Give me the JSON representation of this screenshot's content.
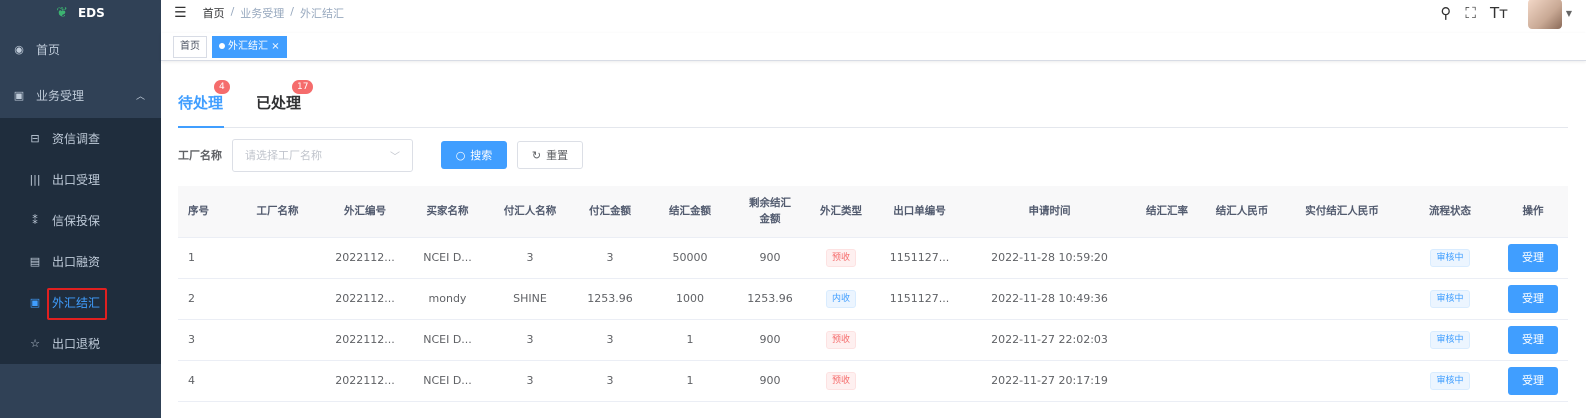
{
  "app": {
    "name": "EDS"
  },
  "sidebar": {
    "items": [
      {
        "label": "首页",
        "icon": "dashboard-icon"
      },
      {
        "label": "业务受理",
        "icon": "documents-icon"
      }
    ],
    "submenu": [
      {
        "label": "资信调查",
        "icon": "credit-icon"
      },
      {
        "label": "出口受理",
        "icon": "export-icon"
      },
      {
        "label": "信保投保",
        "icon": "insurance-icon"
      },
      {
        "label": "出口融资",
        "icon": "financing-icon"
      },
      {
        "label": "外汇结汇",
        "icon": "fx-icon",
        "active": true
      },
      {
        "label": "出口退税",
        "icon": "star-icon"
      }
    ]
  },
  "breadcrumb": {
    "home": "首页",
    "sep": "/",
    "parent": "业务受理",
    "current": "外汇结汇"
  },
  "tags": {
    "home": "首页",
    "current": "外汇结汇",
    "close": "×"
  },
  "tabs": [
    {
      "label": "待处理",
      "badge": "4"
    },
    {
      "label": "已处理",
      "badge": "17"
    }
  ],
  "filter": {
    "label": "工厂名称",
    "placeholder": "请选择工厂名称",
    "search": "搜索",
    "reset": "重置"
  },
  "table": {
    "headers": [
      "序号",
      "工厂名称",
      "外汇编号",
      "买家名称",
      "付汇人名称",
      "付汇金额",
      "结汇金额",
      "剩余结汇金额",
      "外汇类型",
      "出口单编号",
      "申请时间",
      "结汇汇率",
      "结汇人民币",
      "实付结汇人民币",
      "流程状态",
      "操作"
    ],
    "rows": [
      {
        "no": "1",
        "factory": "",
        "fx_no": "2022112...",
        "buyer": "NCEI D...",
        "payer": "3",
        "pay_amt": "3",
        "settle_amt": "50000",
        "remain": "900",
        "type": "预收",
        "type_color": "red",
        "export_no": "1151127...",
        "time": "2022-11-28 10:59:20",
        "rate": "",
        "rmb": "",
        "paid_rmb": "",
        "status": "审核中",
        "op": "受理"
      },
      {
        "no": "2",
        "factory": "",
        "fx_no": "2022112...",
        "buyer": "mondy",
        "payer": "SHINE",
        "pay_amt": "1253.96",
        "settle_amt": "1000",
        "remain": "1253.96",
        "type": "内收",
        "type_color": "blue",
        "export_no": "1151127...",
        "time": "2022-11-28 10:49:36",
        "rate": "",
        "rmb": "",
        "paid_rmb": "",
        "status": "审核中",
        "op": "受理"
      },
      {
        "no": "3",
        "factory": "",
        "fx_no": "2022112...",
        "buyer": "NCEI D...",
        "payer": "3",
        "pay_amt": "3",
        "settle_amt": "1",
        "remain": "900",
        "type": "预收",
        "type_color": "red",
        "export_no": "",
        "time": "2022-11-27 22:02:03",
        "rate": "",
        "rmb": "",
        "paid_rmb": "",
        "status": "审核中",
        "op": "受理"
      },
      {
        "no": "4",
        "factory": "",
        "fx_no": "2022112...",
        "buyer": "NCEI D...",
        "payer": "3",
        "pay_amt": "3",
        "settle_amt": "1",
        "remain": "900",
        "type": "预收",
        "type_color": "red",
        "export_no": "",
        "time": "2022-11-27 20:17:19",
        "rate": "",
        "rmb": "",
        "paid_rmb": "",
        "status": "审核中",
        "op": "受理"
      }
    ]
  },
  "colors": {
    "sidebar": "#304156",
    "submenu": "#1f2d3d",
    "accent": "#409eff",
    "badge": "#f56c6c"
  }
}
